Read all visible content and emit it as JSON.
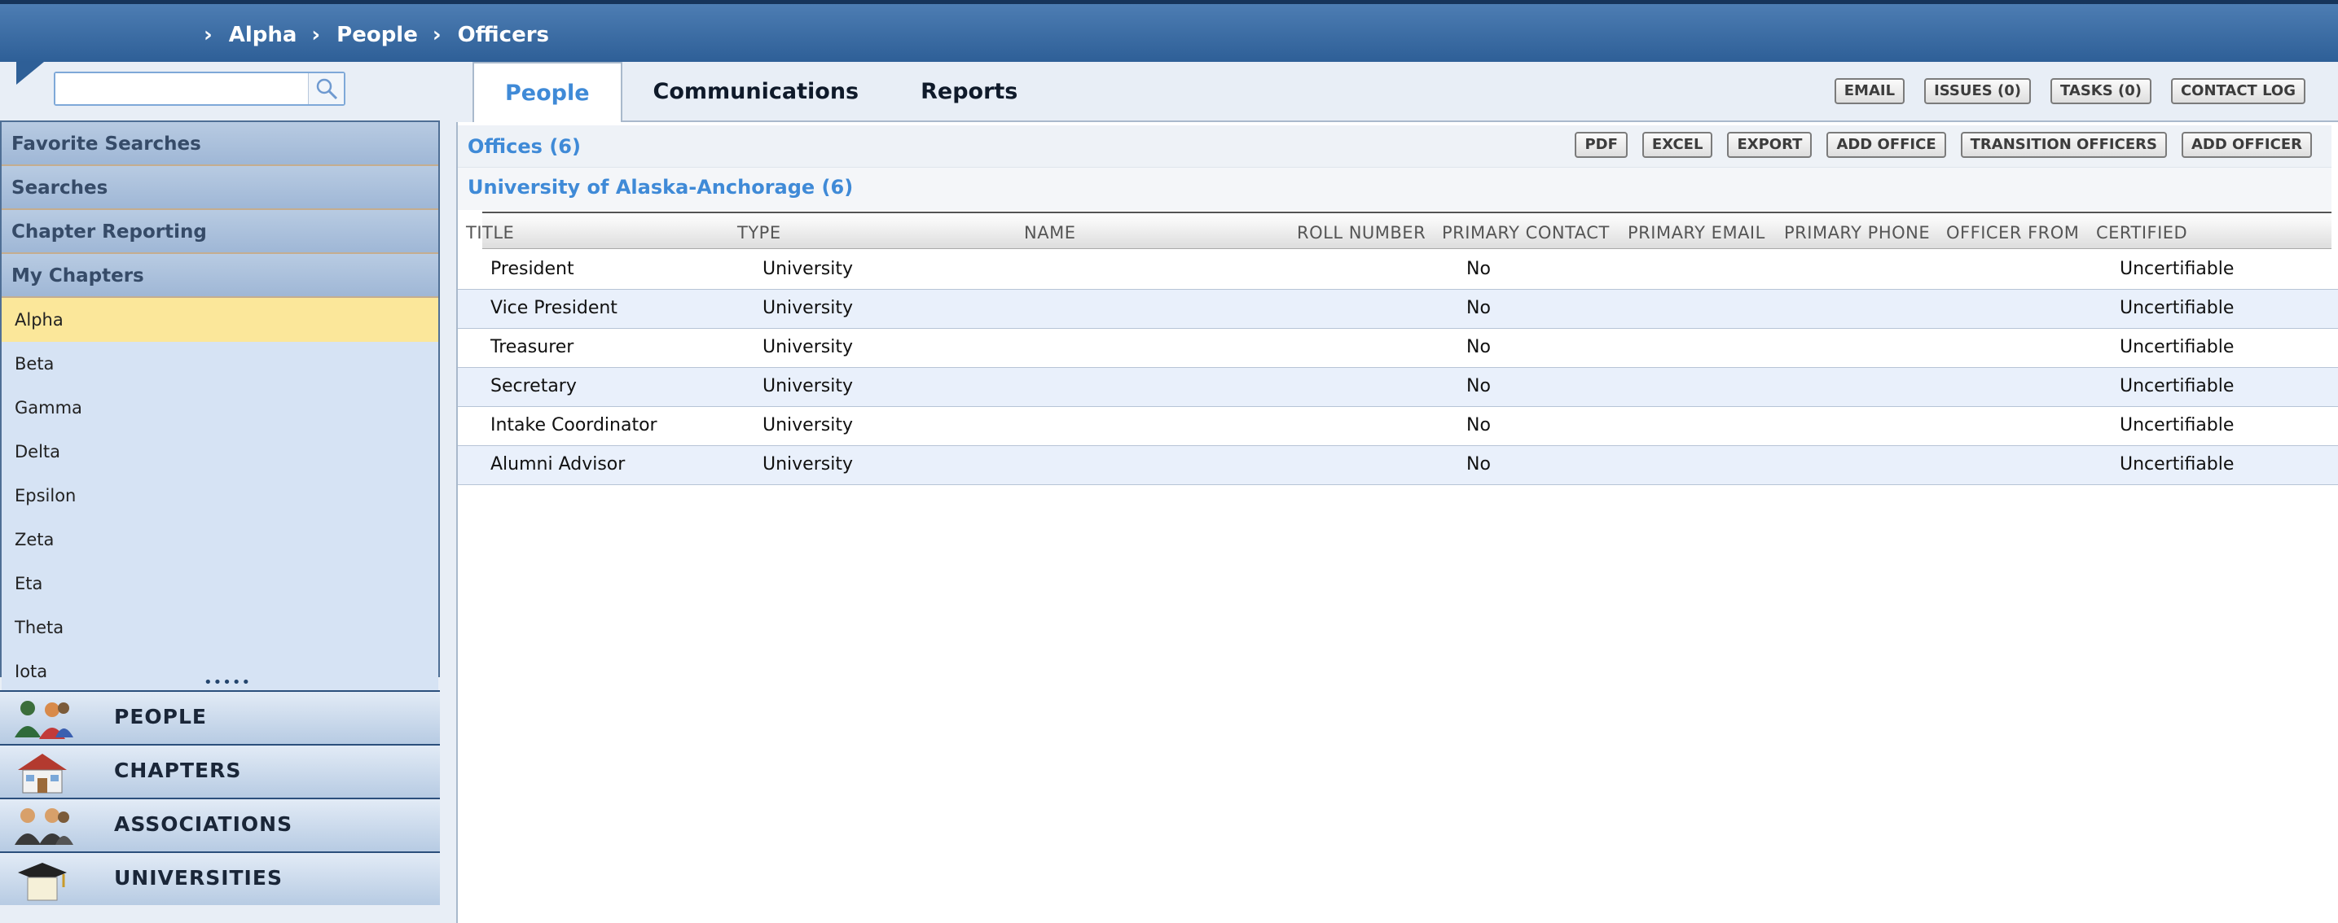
{
  "breadcrumbs": [
    "Alpha",
    "People",
    "Officers"
  ],
  "search": {
    "value": "",
    "placeholder": ""
  },
  "sidebar": {
    "headers": [
      "Favorite Searches",
      "Searches",
      "Chapter Reporting",
      "My Chapters"
    ],
    "chapters": [
      "Alpha",
      "Beta",
      "Gamma",
      "Delta",
      "Epsilon",
      "Zeta",
      "Eta",
      "Theta",
      "Iota"
    ],
    "active_chapter": "Alpha"
  },
  "modules": [
    "PEOPLE",
    "CHAPTERS",
    "ASSOCIATIONS",
    "UNIVERSITIES"
  ],
  "tabs": [
    "People",
    "Communications",
    "Reports"
  ],
  "active_tab": "People",
  "top_actions": [
    "EMAIL",
    "ISSUES (0)",
    "TASKS (0)",
    "CONTACT LOG"
  ],
  "offices": {
    "title": "Offices (6)",
    "actions": [
      "PDF",
      "EXCEL",
      "EXPORT",
      "ADD OFFICE",
      "TRANSITION OFFICERS",
      "ADD OFFICER"
    ],
    "group_title": "University of Alaska-Anchorage (6)",
    "columns": [
      "TITLE",
      "TYPE",
      "NAME",
      "ROLL NUMBER",
      "PRIMARY CONTACT",
      "PRIMARY EMAIL",
      "PRIMARY PHONE",
      "OFFICER FROM",
      "CERTIFIED"
    ],
    "rows": [
      {
        "title": "President",
        "type": "University",
        "name": "",
        "roll": "",
        "contact": "No",
        "email": "",
        "phone": "",
        "from": "",
        "certified": "Uncertifiable"
      },
      {
        "title": "Vice President",
        "type": "University",
        "name": "",
        "roll": "",
        "contact": "No",
        "email": "",
        "phone": "",
        "from": "",
        "certified": "Uncertifiable"
      },
      {
        "title": "Treasurer",
        "type": "University",
        "name": "",
        "roll": "",
        "contact": "No",
        "email": "",
        "phone": "",
        "from": "",
        "certified": "Uncertifiable"
      },
      {
        "title": "Secretary",
        "type": "University",
        "name": "",
        "roll": "",
        "contact": "No",
        "email": "",
        "phone": "",
        "from": "",
        "certified": "Uncertifiable"
      },
      {
        "title": "Intake Coordinator",
        "type": "University",
        "name": "",
        "roll": "",
        "contact": "No",
        "email": "",
        "phone": "",
        "from": "",
        "certified": "Uncertifiable"
      },
      {
        "title": "Alumni Advisor",
        "type": "University",
        "name": "",
        "roll": "",
        "contact": "No",
        "email": "",
        "phone": "",
        "from": "",
        "certified": "Uncertifiable"
      }
    ]
  },
  "colors": {
    "accent": "#3f8ad7",
    "header": "#2e5f97",
    "highlight": "#fbe79a"
  }
}
